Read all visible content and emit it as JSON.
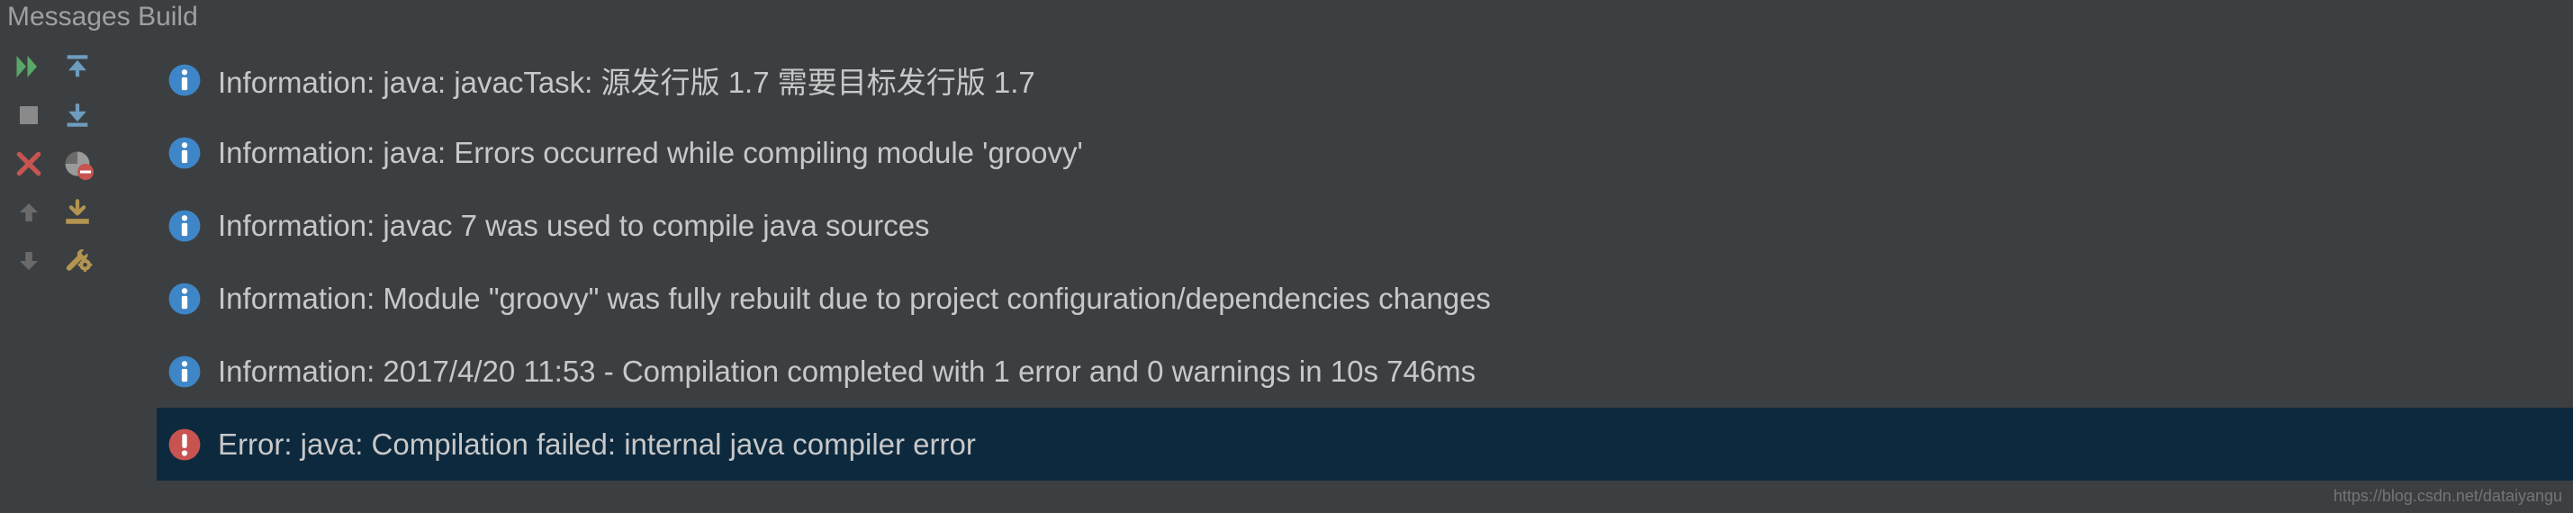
{
  "panelTitle": "Messages Build",
  "messages": [
    {
      "type": "info",
      "text": "Information: java: javacTask: 源发行版 1.7 需要目标发行版 1.7",
      "selected": false
    },
    {
      "type": "info",
      "text": "Information: java: Errors occurred while compiling module 'groovy'",
      "selected": false
    },
    {
      "type": "info",
      "text": "Information: javac 7 was used to compile java sources",
      "selected": false
    },
    {
      "type": "info",
      "text": "Information: Module \"groovy\" was fully rebuilt due to project configuration/dependencies changes",
      "selected": false
    },
    {
      "type": "info",
      "text": "Information: 2017/4/20 11:53 - Compilation completed with 1 error and 0 warnings in 10s 746ms",
      "selected": false
    },
    {
      "type": "error",
      "text": "Error: java: Compilation failed: internal java compiler error",
      "selected": true
    }
  ],
  "watermark": "https://blog.csdn.net/dataiyangu"
}
